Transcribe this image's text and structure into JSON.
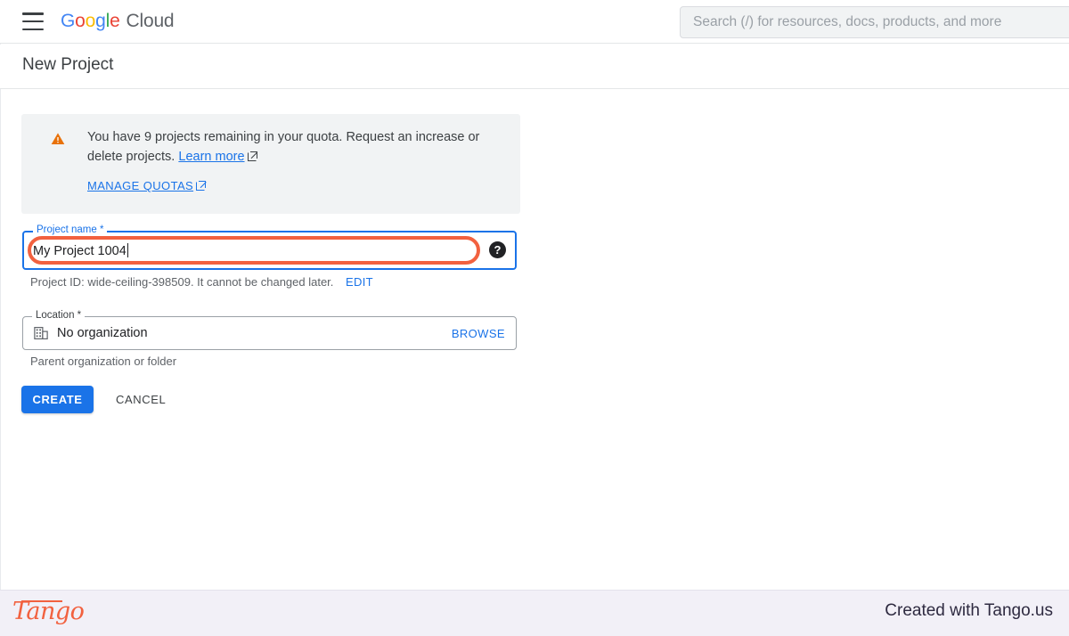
{
  "topbar": {
    "menu_icon": "hamburger-menu-icon",
    "brand": {
      "g": "G",
      "o1": "o",
      "o2": "o",
      "g2": "g",
      "l": "l",
      "e": "e",
      "cloud": "Cloud"
    },
    "search": {
      "placeholder": "Search (/) for resources, docs, products, and more",
      "value": ""
    }
  },
  "page": {
    "title": "New Project"
  },
  "banner": {
    "icon": "warning-triangle-icon",
    "text_before_link": "You have 9 projects remaining in your quota. Request an increase or delete projects.",
    "learn_more": "Learn more",
    "manage_quotas": "MANAGE QUOTAS",
    "external_link_icon": "external-link-icon"
  },
  "project_name": {
    "label": "Project name *",
    "value": "My Project 1004",
    "help_icon": "help-question-icon",
    "project_id_prefix": "Project ID:",
    "project_id": "wide-ceiling-398509",
    "project_id_suffix": ". It cannot be changed later.",
    "edit_label": "EDIT",
    "highlight_color": "#F2613F",
    "focus_color": "#1a73e8"
  },
  "location": {
    "label": "Location *",
    "icon": "organization-building-icon",
    "value": "No organization",
    "browse_label": "BROWSE",
    "helper_text": "Parent organization or folder"
  },
  "actions": {
    "create_label": "CREATE",
    "cancel_label": "CANCEL",
    "create_color": "#1a73e8"
  },
  "footer": {
    "logo_text": "Tango",
    "credit": "Created with Tango.us",
    "accent_color": "#F2613F",
    "background": "#f2f0f7"
  }
}
